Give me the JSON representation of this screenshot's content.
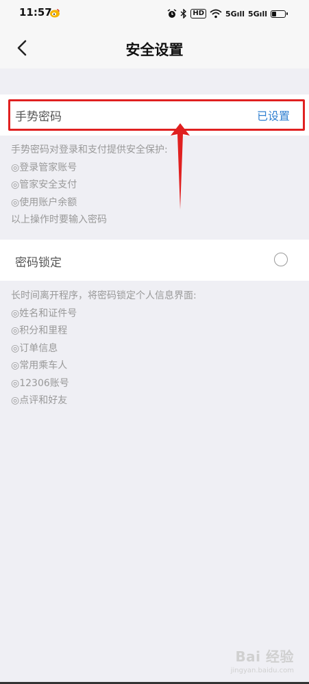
{
  "status_bar": {
    "time": "11:57",
    "app_icon": "weibo-icon",
    "icons": [
      "alarm-icon",
      "bluetooth-icon",
      "hd-icon",
      "wifi-icon",
      "5g-signal-icon",
      "5g-signal-icon",
      "battery-icon"
    ],
    "hd_label": "HD",
    "signal_1": "5Gıll",
    "signal_2": "5Gıll"
  },
  "nav": {
    "title": "安全设置",
    "back_icon": "chevron-left-icon"
  },
  "gesture_password": {
    "label": "手势密码",
    "status": "已设置",
    "status_color": "#2f7fd0"
  },
  "gesture_desc": {
    "line1": "手势密码对登录和支付提供安全保护:",
    "line2": "◎登录管家账号",
    "line3": "◎管家安全支付",
    "line4": "◎使用账户余额",
    "line5": "以上操作时要输入密码"
  },
  "password_lock": {
    "label": "密码锁定",
    "checked": false
  },
  "lock_desc": {
    "line1": "长时间离开程序，将密码锁定个人信息界面:",
    "line2": "◎姓名和证件号",
    "line3": "◎积分和里程",
    "line4": "◎订单信息",
    "line5": "◎常用乘车人",
    "line6": "◎12306账号",
    "line7": "◎点评和好友"
  },
  "annotation": {
    "highlight_color": "#e02020"
  },
  "watermark": {
    "main": "Bai 经验",
    "sub": "jingyan.baidu.com"
  }
}
